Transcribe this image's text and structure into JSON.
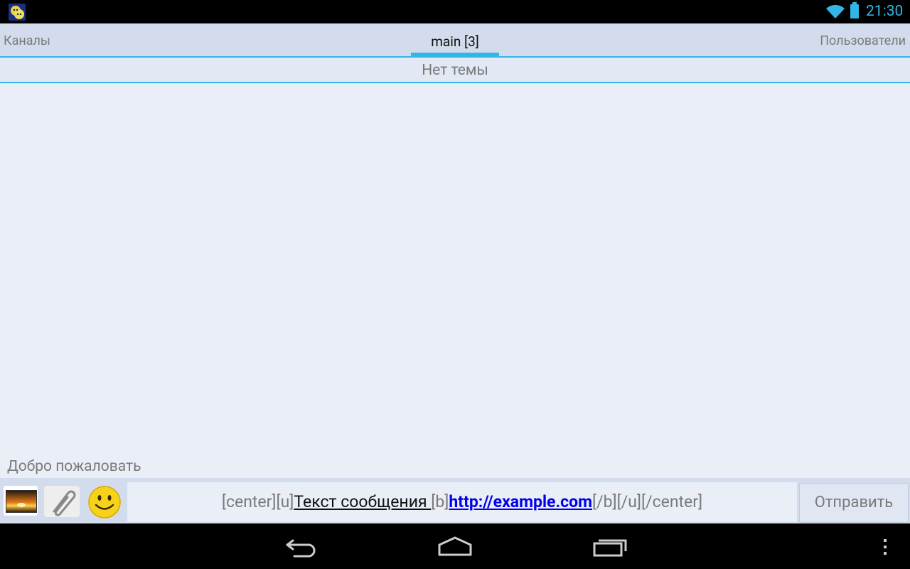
{
  "status": {
    "time": "21:30"
  },
  "tabs": {
    "left": "Каналы",
    "center": "main [3]",
    "right": "Пользователи"
  },
  "topic": "Нет темы",
  "chat": {
    "welcome": "Добро пожаловать"
  },
  "input": {
    "prefix": "[center][u]",
    "underlined": "Текст сообщения ",
    "tag_b": "[b]",
    "link": "http://example.com",
    "suffix": "[/b][/u][/center]",
    "send_label": "Отправить"
  },
  "icons": {
    "app": "app-icon",
    "wifi": "wifi-icon",
    "battery": "battery-icon",
    "image": "image-icon",
    "attach": "paperclip-icon",
    "emoji": "smiley-icon",
    "back": "back-icon",
    "home": "home-icon",
    "recent": "recent-apps-icon",
    "menu": "overflow-menu-icon"
  },
  "colors": {
    "accent": "#33b5e5",
    "link": "#0000ee"
  }
}
